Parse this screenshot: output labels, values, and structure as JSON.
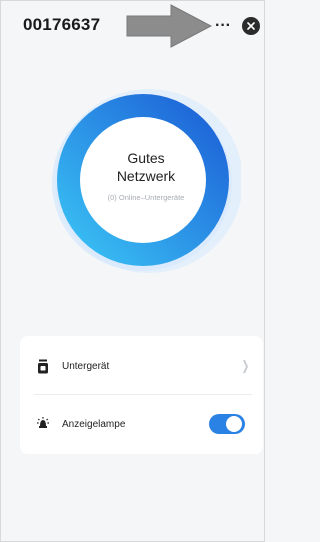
{
  "header": {
    "title": "00176637",
    "more_label": "···"
  },
  "status": {
    "line1": "Gutes",
    "line2": "Netzwerk",
    "subtitle": "(0) Online–Untergeräte"
  },
  "settings": {
    "items": [
      {
        "label": "Untergerät",
        "icon": "subdevice-icon",
        "control": "chevron"
      },
      {
        "label": "Anzeigelampe",
        "icon": "lamp-icon",
        "control": "toggle",
        "enabled": true
      }
    ]
  },
  "colors": {
    "ring_start": "#36c2f5",
    "ring_end": "#1a5fd6",
    "toggle_on": "#2a82e4",
    "background": "#f5f6f8"
  }
}
